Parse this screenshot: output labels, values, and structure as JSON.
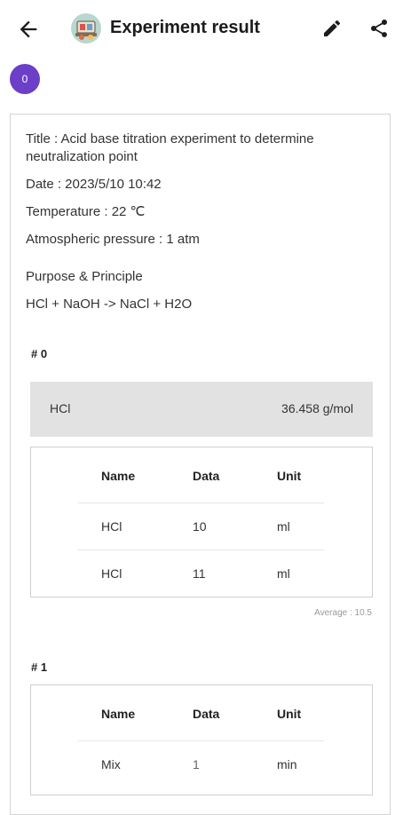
{
  "header": {
    "title": "Experiment result",
    "back_icon": "arrow-back-icon",
    "app_icon": "lab-app-icon",
    "edit_icon": "pencil-icon",
    "share_icon": "share-icon"
  },
  "badge": {
    "count": "0"
  },
  "experiment": {
    "title_line1": "Title : Acid base titration experiment to determine",
    "title_line2": "neutralization point",
    "date": "Date : 2023/5/10 10:42",
    "temperature": "Temperature : 22 ℃",
    "pressure": "Atmospheric pressure : 1 atm",
    "purpose_label": "Purpose & Principle",
    "purpose_text": "HCl + NaOH -> NaCl + H2O"
  },
  "sections": [
    {
      "label": "# 0",
      "chemical": {
        "name": "HCl",
        "molar_mass": "36.458 g/mol"
      },
      "table": {
        "headers": [
          "Name",
          "Data",
          "Unit"
        ],
        "rows": [
          [
            "HCl",
            "10",
            "ml"
          ],
          [
            "HCl",
            "11",
            "ml"
          ]
        ]
      },
      "average": "Average : 10.5"
    },
    {
      "label": "# 1",
      "table": {
        "headers": [
          "Name",
          "Data",
          "Unit"
        ],
        "rows": [
          [
            "Mix",
            "1",
            "min"
          ]
        ]
      }
    }
  ]
}
